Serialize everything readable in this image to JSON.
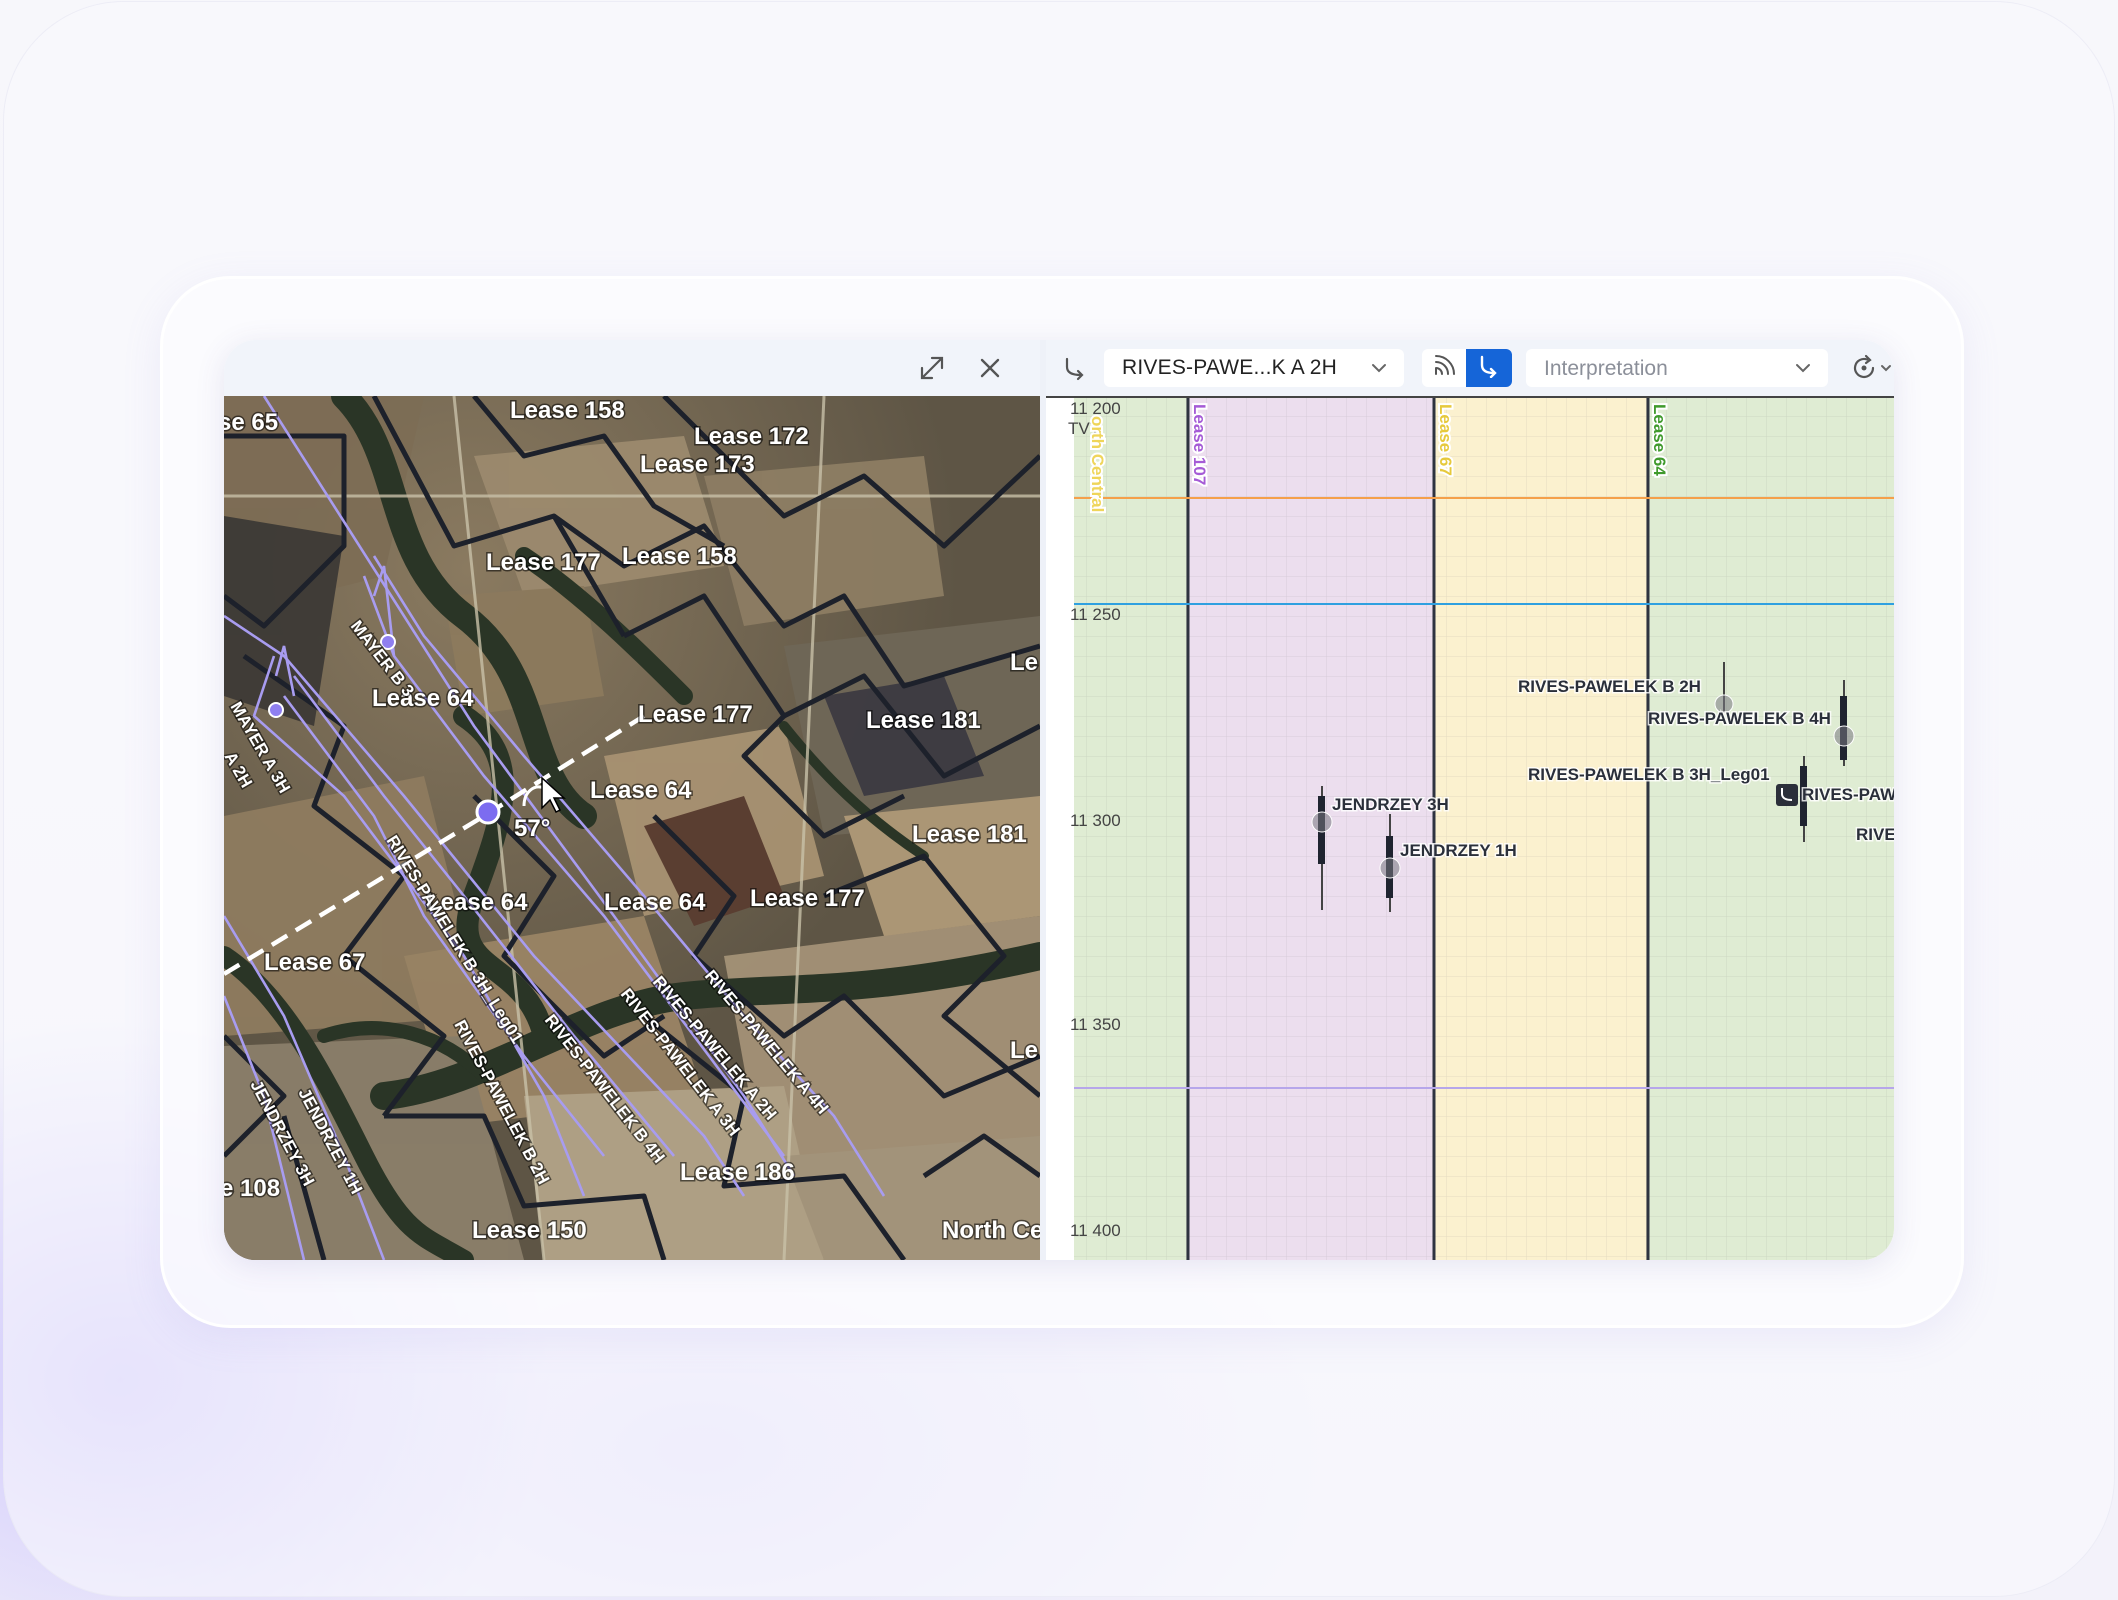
{
  "map": {
    "lease_labels": [
      {
        "id": "lease-65",
        "text": "se 65"
      },
      {
        "id": "lease-158-a",
        "text": "Lease 158"
      },
      {
        "id": "lease-172",
        "text": "Lease 172"
      },
      {
        "id": "lease-173",
        "text": "Lease 173"
      },
      {
        "id": "lease-177-a",
        "text": "Lease 177"
      },
      {
        "id": "lease-158-b",
        "text": "Lease 158"
      },
      {
        "id": "lease-le-a",
        "text": "Le"
      },
      {
        "id": "lease-64-a",
        "text": "Lease 64"
      },
      {
        "id": "lease-177-b",
        "text": "Lease 177"
      },
      {
        "id": "lease-181-a",
        "text": "Lease 181"
      },
      {
        "id": "lease-64-b",
        "text": "Lease 64"
      },
      {
        "id": "lease-181-b",
        "text": "Lease 181"
      },
      {
        "id": "lease-64-c",
        "text": "Lease 64"
      },
      {
        "id": "lease-64-d",
        "text": "Lease 64"
      },
      {
        "id": "lease-177-c",
        "text": "Lease 177"
      },
      {
        "id": "lease-67",
        "text": "Lease 67"
      },
      {
        "id": "lease-le-b",
        "text": "Le"
      },
      {
        "id": "lease-186",
        "text": "Lease 186"
      },
      {
        "id": "lease-108",
        "text": "e 108"
      },
      {
        "id": "lease-150",
        "text": "Lease 150"
      },
      {
        "id": "lease-north",
        "text": "North Ce"
      }
    ],
    "well_labels": [
      {
        "id": "mayer-b",
        "text": "MAYER B 3"
      },
      {
        "id": "mayer-a",
        "text": "MAYER A 3H"
      },
      {
        "id": "mayer-a2",
        "text": "A 2H"
      },
      {
        "id": "rp-b-3h",
        "text": "RIVES-PAWELEK B 3H_Leg01"
      },
      {
        "id": "rp-b-2h",
        "text": "RIVES-PAWELEK B 2H"
      },
      {
        "id": "rp-b-4h",
        "text": "RIVES-PAWELEK B 4H"
      },
      {
        "id": "rp-a-3h",
        "text": "RIVES-PAWELEK A 3H"
      },
      {
        "id": "rp-a-2h",
        "text": "RIVES-PAWELEK A 2H"
      },
      {
        "id": "rp-a-4h",
        "text": "RIVES-PAWELEK A 4H"
      },
      {
        "id": "jendrzey-3h",
        "text": "JENDRZEY 3H"
      },
      {
        "id": "jendrzey-1h",
        "text": "JENDRZEY 1H"
      }
    ],
    "angle_label": "57°",
    "icons": [
      "expand-icon",
      "close-icon"
    ]
  },
  "toolbar": {
    "well_value": "RIVES-PAWE...K A 2H",
    "interpretation_placeholder": "Interpretation",
    "icons": [
      "well-path-icon",
      "chevron-down-icon",
      "signal-icon",
      "well-toggle-icon",
      "sync-icon"
    ],
    "accent": "#1565d8"
  },
  "section": {
    "axis_unit": "TVT",
    "ticks": [
      {
        "id": "t11200",
        "text": "11 200"
      },
      {
        "id": "t11250",
        "text": "11 250"
      },
      {
        "id": "t11300",
        "text": "11 300"
      },
      {
        "id": "t11350",
        "text": "11 350"
      },
      {
        "id": "t11400",
        "text": "11 400"
      }
    ],
    "lease_columns": [
      {
        "id": "north-central",
        "text": "orth Central",
        "color": "#f6e27a"
      },
      {
        "id": "lease-107",
        "text": "Lease 107",
        "color": "#a55bd6"
      },
      {
        "id": "lease-67",
        "text": "Lease 67",
        "color": "#f1d548"
      },
      {
        "id": "lease-64",
        "text": "Lease 64",
        "color": "#3f9a2c"
      }
    ],
    "wells": [
      {
        "id": "jendrzey-3h",
        "text": "JENDRZEY 3H"
      },
      {
        "id": "jendrzey-1h",
        "text": "JENDRZEY 1H"
      },
      {
        "id": "rp-b-2h",
        "text": "RIVES-PAWELEK B 2H"
      },
      {
        "id": "rp-b-4h",
        "text": "RIVES-PAWELEK B 4H"
      },
      {
        "id": "rp-b-3h",
        "text": "RIVES-PAWELEK B 3H_Leg01"
      },
      {
        "id": "rp-cut",
        "text": "RIVES-PAWE"
      },
      {
        "id": "rive-cut",
        "text": "RIVE"
      }
    ],
    "horizon_colors": [
      "#f5a04a",
      "#2fa0e0",
      "#b6a6ea"
    ]
  }
}
